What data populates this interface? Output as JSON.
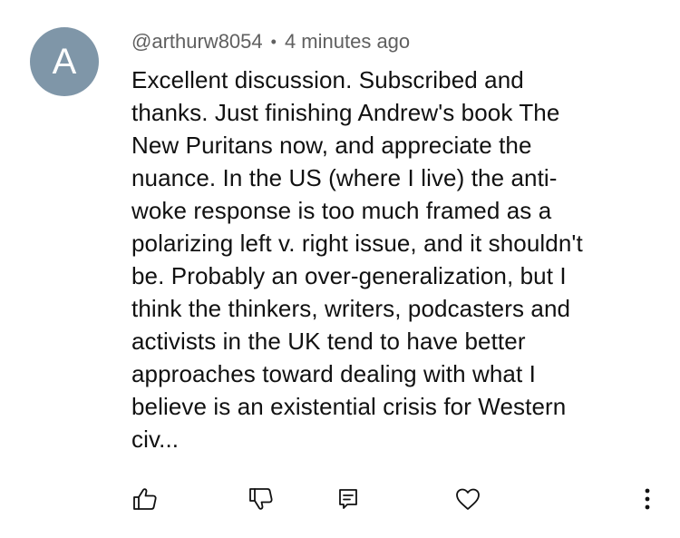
{
  "comment": {
    "avatar_letter": "A",
    "avatar_color": "#7f96a8",
    "username": "@arthurw8054",
    "separator": "•",
    "timestamp": "4 minutes ago",
    "text_lines": [
      "Excellent discussion. Subscribed and",
      "thanks. Just finishing Andrew's book The",
      "New Puritans now, and appreciate the",
      "nuance. In the US (where I live) the anti-",
      "woke response is too much framed as a",
      "polarizing left v. right issue, and it shouldn't",
      "be. Probably an over-generalization, but I",
      "think the thinkers, writers, podcasters and",
      "activists in the UK tend to have better",
      "approaches toward dealing with what I",
      "believe is an existential crisis for Western",
      "civ..."
    ]
  },
  "actions": {
    "like_icon": "thumbs-up-icon",
    "dislike_icon": "thumbs-down-icon",
    "reply_icon": "reply-icon",
    "heart_icon": "heart-icon",
    "more_icon": "more-vertical-icon"
  }
}
